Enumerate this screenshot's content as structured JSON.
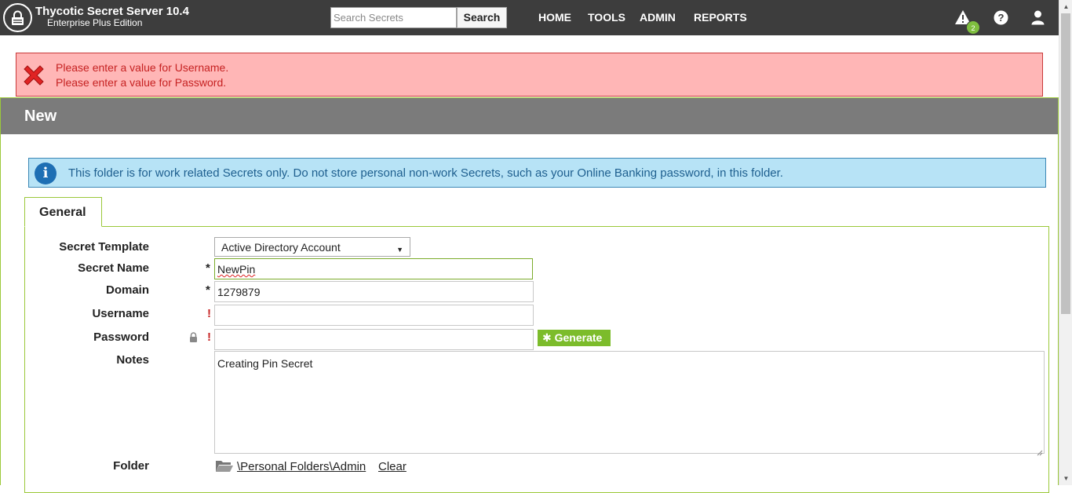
{
  "header": {
    "app_title": "Thycotic Secret Server 10.4",
    "edition": "Enterprise Plus Edition",
    "search_placeholder": "Search Secrets",
    "search_button": "Search",
    "nav": [
      "HOME",
      "TOOLS",
      "ADMIN",
      "REPORTS"
    ],
    "notification_count": "2",
    "icons": [
      "lock-logo-icon",
      "alert-icon",
      "help-icon",
      "user-icon"
    ]
  },
  "errors": [
    "Please enter a value for Username.",
    "Please enter a value for Password."
  ],
  "page": {
    "title": "New",
    "info_message": "This folder is for work related Secrets only. Do not store personal non-work Secrets, such as your Online Banking password, in this folder.",
    "tab": "General"
  },
  "form": {
    "secret_template": {
      "label": "Secret Template",
      "value": "Active Directory Account"
    },
    "secret_name": {
      "label": "Secret Name",
      "value": "NewPin",
      "marker": "*"
    },
    "domain": {
      "label": "Domain",
      "value": "1279879",
      "marker": "*"
    },
    "username": {
      "label": "Username",
      "value": "",
      "marker": "!"
    },
    "password": {
      "label": "Password",
      "value": "",
      "marker": "!"
    },
    "generate_button": "Generate",
    "notes": {
      "label": "Notes",
      "value": "Creating Pin Secret"
    },
    "folder": {
      "label": "Folder",
      "path": "\\Personal Folders\\Admin",
      "clear_label": "Clear"
    }
  },
  "colors": {
    "topbar": "#3d3d3d",
    "error_bg": "#ffb6b6",
    "info_bg": "#b7e3f6",
    "accent_green": "#7cbc2b",
    "panel_header": "#7b7b7b"
  }
}
